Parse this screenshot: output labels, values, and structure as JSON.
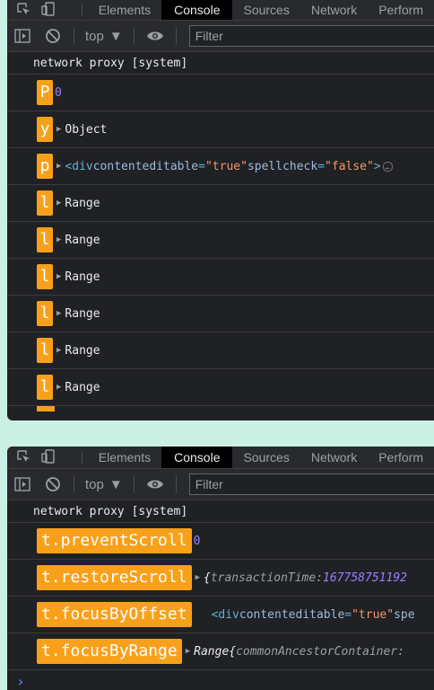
{
  "colors": {
    "background": "#c9f0e2",
    "panel": "#202124",
    "badge": "#f9a01b",
    "number": "#9980ff",
    "tag": "#5db0d7",
    "attr_value": "#f29766"
  },
  "devtools": {
    "tabs": [
      "Elements",
      "Console",
      "Sources",
      "Network",
      "Perform"
    ],
    "active_tab": "Console",
    "context": "top",
    "filter_placeholder": "Filter",
    "system_line": "network proxy [system]",
    "icons": {
      "inspect": "inspect-element-icon",
      "device": "device-toolbar-icon",
      "sidebar": "sidebar-toggle-icon",
      "clear": "clear-console-icon",
      "dropdown": "chevron-down-icon",
      "eye": "live-expression-eye-icon"
    }
  },
  "panel1": {
    "rows": [
      {
        "badge": "P",
        "type": "number",
        "value": "0"
      },
      {
        "badge": "y",
        "type": "object",
        "value": "Object"
      },
      {
        "badge": "p",
        "type": "element",
        "tag_open": "<div ",
        "attr1": "contenteditable",
        "eq1": "=",
        "val1": "\"true\"",
        "attr2": " spellcheck",
        "eq2": "=",
        "val2": "\"false\"",
        "tag_close": ">",
        "ellipsis": "…"
      },
      {
        "badge": "l",
        "type": "object",
        "value": "Range"
      },
      {
        "badge": "l",
        "type": "object",
        "value": "Range"
      },
      {
        "badge": "l",
        "type": "object",
        "value": "Range"
      },
      {
        "badge": "l",
        "type": "object",
        "value": "Range"
      },
      {
        "badge": "l",
        "type": "object",
        "value": "Range"
      },
      {
        "badge": "l",
        "type": "object",
        "value": "Range"
      }
    ]
  },
  "panel2": {
    "rows": [
      {
        "badge": "t.preventScroll",
        "value": "0"
      },
      {
        "badge": "t.restoreScroll",
        "open": "{",
        "key": "transactionTime",
        "colon": ": ",
        "val": "167758751192"
      },
      {
        "badge": "t.focusByOffset",
        "tag_open": "<div ",
        "attr1": "contenteditable",
        "eq1": "=",
        "val1": "\"true\"",
        "attr2": " spe"
      },
      {
        "badge": "t.focusByRange",
        "type_name": "Range ",
        "open": "{",
        "key": "commonAncestorContainer",
        "colon": ":"
      }
    ],
    "prompt": "›"
  }
}
